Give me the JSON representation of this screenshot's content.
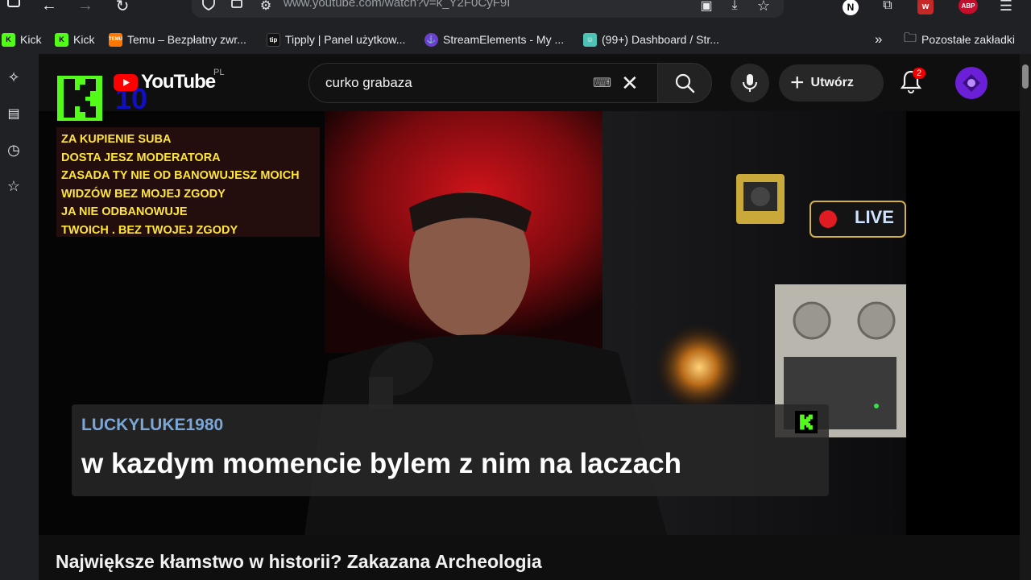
{
  "browser": {
    "url": "www.youtube.com/watch?v=k_Y2F0CyF9I",
    "abp_label": "ABP",
    "bookmarks": [
      {
        "label": "Kick",
        "icon": "kick-icon",
        "color": "#53fc18"
      },
      {
        "label": "Kick",
        "icon": "kick-icon",
        "color": "#53fc18"
      },
      {
        "label": "Temu – Bezpłatny zwr...",
        "icon": "temu-icon",
        "color": "#fb7701"
      },
      {
        "label": "Tipply | Panel użytkow...",
        "icon": "tipply-icon",
        "color": "#111111"
      },
      {
        "label": "StreamElements - My ...",
        "icon": "streamelements-icon",
        "color": "#6b3fd1"
      },
      {
        "label": "(99+) Dashboard / Str...",
        "icon": "discord-icon",
        "color": "#4cc3b5"
      }
    ],
    "other_bookmarks": "Pozostałe zakładki"
  },
  "youtube": {
    "logo_text": "YouTube",
    "region": "PL",
    "search_value": "curko grabaza",
    "create_label": "Utwórz",
    "notification_count": "2"
  },
  "stream_overlay": {
    "badge_number": "10",
    "rules": [
      "ZA KUPIENIE SUBA",
      "DOSTA JESZ MODERATORA",
      "ZASADA  TY NIE OD BANOWUJESZ MOICH",
      "WIDZÓW BEZ MOJEJ ZGODY",
      "JA NIE ODBANOWUJE",
      "TWOICH . BEZ TWOJEJ ZGODY"
    ],
    "live_sign": "LIVE",
    "chat_username": "LUCKYLUKE1980",
    "chat_message": "w kazdym momencie bylem z nim na laczach"
  },
  "video_title": "Największe kłamstwo w historii? Zakazana Archeologia",
  "colors": {
    "kick_green": "#53fc18",
    "youtube_red": "#ff0000",
    "overlay_yellow": "#ffe53a",
    "chat_username": "#7aa6d8"
  }
}
